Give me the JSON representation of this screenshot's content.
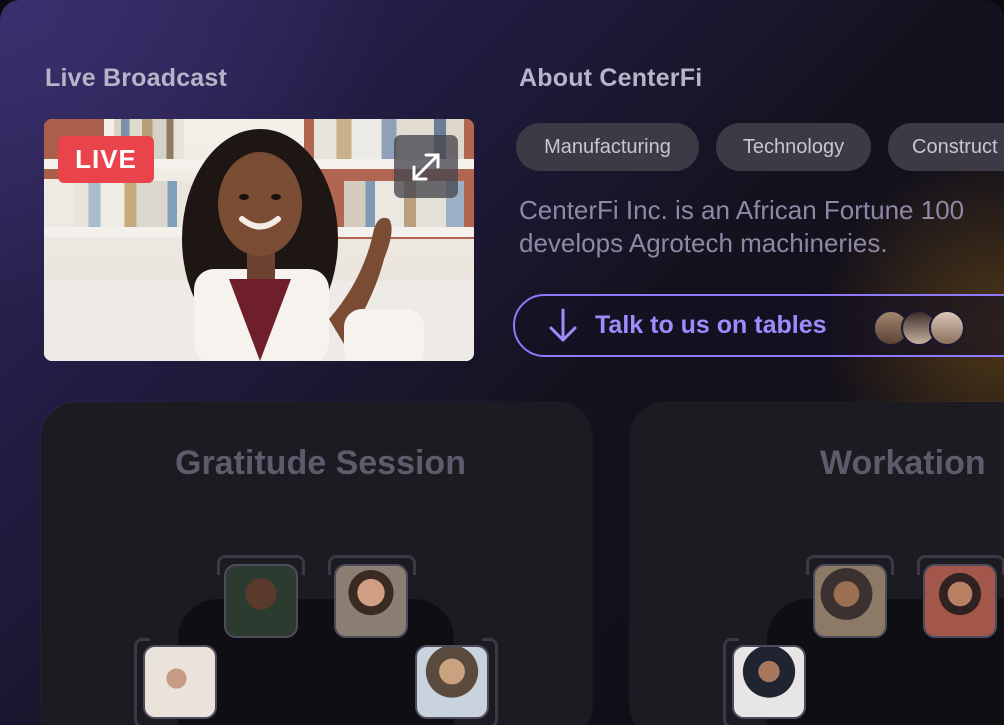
{
  "broadcast": {
    "title": "Live Broadcast",
    "live_label": "LIVE",
    "expand_icon": "expand-icon"
  },
  "about": {
    "title": "About CenterFi",
    "tags": [
      "Manufacturing",
      "Technology",
      "Construct"
    ],
    "description_line1": "CenterFi Inc. is an African Fortune 100",
    "description_line2": "develops Agrotech machineries.",
    "cta_label": "Talk to us on tables",
    "cta_icon": "arrow-down-icon"
  },
  "rooms": [
    {
      "title": "Gratitude Session"
    },
    {
      "title": "Workation"
    }
  ],
  "colors": {
    "live_red": "#e9444c",
    "accent_purple": "#8f79ff",
    "chip_bg": "#3b3a45",
    "room_bg": "#1c1b21"
  }
}
